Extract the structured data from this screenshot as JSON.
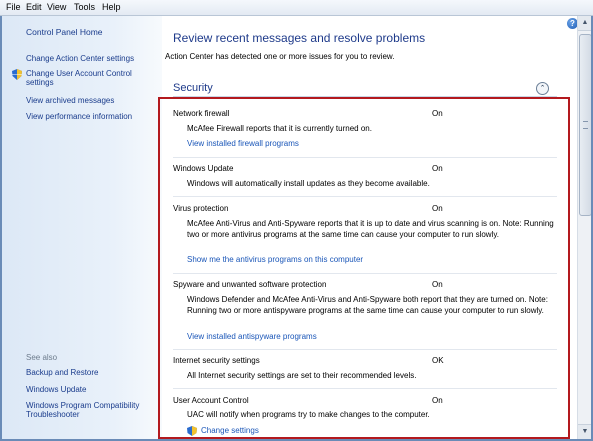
{
  "menu": [
    "File",
    "Edit",
    "View",
    "Tools",
    "Help"
  ],
  "sidebar": {
    "home": "Control Panel Home",
    "items": [
      "Change Action Center settings",
      "Change User Account Control settings",
      "View archived messages",
      "View performance information"
    ],
    "see_also_label": "See also",
    "see_also": [
      "Backup and Restore",
      "Windows Update",
      "Windows Program Compatibility Troubleshooter"
    ]
  },
  "main": {
    "title": "Review recent messages and resolve problems",
    "subtitle": "Action Center has detected one or more issues for you to review.",
    "section_title": "Security",
    "items": [
      {
        "name": "Network firewall",
        "status": "On",
        "desc": "McAfee Firewall reports that it is currently turned on.",
        "link": "View installed firewall programs"
      },
      {
        "name": "Windows Update",
        "status": "On",
        "desc": "Windows will automatically install updates as they become available.",
        "link": ""
      },
      {
        "name": "Virus protection",
        "status": "On",
        "desc": "McAfee Anti-Virus and Anti-Spyware reports that it is up to date and virus scanning is on. Note: Running two or more antivirus programs at the same time can cause your computer to run slowly.",
        "link": "Show me the antivirus programs on this computer"
      },
      {
        "name": "Spyware and unwanted software protection",
        "status": "On",
        "desc": "Windows Defender and McAfee Anti-Virus and Anti-Spyware both report that they are turned on. Note: Running two or more antispyware programs at the same time can cause your computer to run slowly.",
        "link": "View installed antispyware programs"
      },
      {
        "name": "Internet security settings",
        "status": "OK",
        "desc": "All Internet security settings are set to their recommended levels.",
        "link": ""
      },
      {
        "name": "User Account Control",
        "status": "On",
        "desc": "UAC will notify when programs try to make changes to the computer.",
        "link": "Change settings"
      }
    ]
  },
  "icons": {
    "help": "help-icon",
    "shield": "uac-shield-icon",
    "collapse": "chevron-up-icon"
  },
  "colors": {
    "accent_red": "#b3191e",
    "link": "#1a56b8",
    "title": "#1e3a8a"
  }
}
